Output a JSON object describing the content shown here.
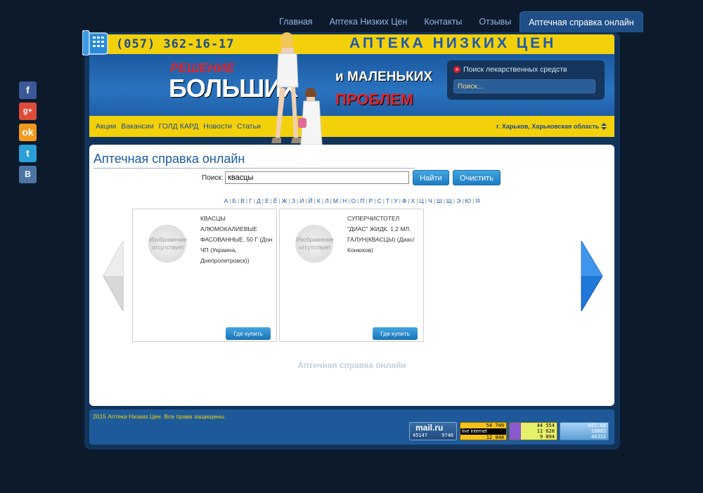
{
  "topnav": {
    "items": [
      "Главная",
      "Аптека Низких Цен",
      "Контакты",
      "Отзывы",
      "Аптечная справка онлайн"
    ]
  },
  "header": {
    "phone": "(057) 362-16-17",
    "brand": "АПТЕКА НИЗКИХ ЦЕН",
    "slogan": {
      "line1": "РЕШЕНИЕ",
      "line2": "БОЛЬШИХ",
      "line3": "и МАЛЕНЬКИХ",
      "line4": "ПРОБЛЕМ"
    },
    "search_label": "Поиск лекарственных средств",
    "search_placeholder": "Поиск...",
    "subnav": [
      "Акции",
      "Вакансии",
      "ГОЛД КАРД",
      "Новости",
      "Статьи"
    ],
    "city": "г. Харьков, Харьковская область"
  },
  "content": {
    "title": "Аптечная справка онлайн",
    "search_label": "Поиск:",
    "search_value": "квасцы",
    "find_button": "Найти",
    "clear_button": "Очистить",
    "letters": [
      "А",
      "Б",
      "В",
      "Г",
      "Д",
      "Е",
      "Ё",
      "Ж",
      "З",
      "И",
      "Й",
      "К",
      "Л",
      "М",
      "Н",
      "О",
      "П",
      "Р",
      "С",
      "Т",
      "У",
      "Ф",
      "Х",
      "Ц",
      "Ч",
      "Ш",
      "Щ",
      "Э",
      "Ю",
      "Я"
    ],
    "products": [
      {
        "noimage": "Изображение отсутствует",
        "name": "КВАСЦЫ АЛЮМОКАЛИЕВЫЕ ФАСОВАННЫЕ, 50 Г (Дон ЧП (Украина, Днепропетровск))",
        "buy": "Где купить"
      },
      {
        "noimage": "Изображение отсутствует",
        "name": "СУПЕРЧИСТОТЕЛ \"ДИАС\" ЖИДК. 1,2 МЛ. ГАЛУН(КВАСЦЫ) (Диас/Конюхов)",
        "buy": "Где купить"
      }
    ],
    "watermark": "Аптечная справка онлайн"
  },
  "footer": {
    "copyright": "2015 Аптека Низких Цен. Все права защищены.",
    "counters": {
      "mailru": {
        "label": "mail.ru",
        "v1": "45147",
        "v2": "9740"
      },
      "liveinternet": {
        "label": "live internet",
        "v1": "54 749",
        "v2": "12 048"
      },
      "third": {
        "v1": "44 554",
        "v2": "11 628",
        "v3": "9 894"
      },
      "hitua": {
        "label": "HIT.UA",
        "v1": "18083",
        "v2": "46322"
      }
    }
  },
  "share": {
    "icons": [
      "facebook-icon",
      "google-plus-icon",
      "odnoklassniki-icon",
      "twitter-icon",
      "vk-icon"
    ],
    "colors": [
      "#3b5998",
      "#dd4b39",
      "#f29a1f",
      "#2ba0d8",
      "#4c75a3"
    ]
  }
}
